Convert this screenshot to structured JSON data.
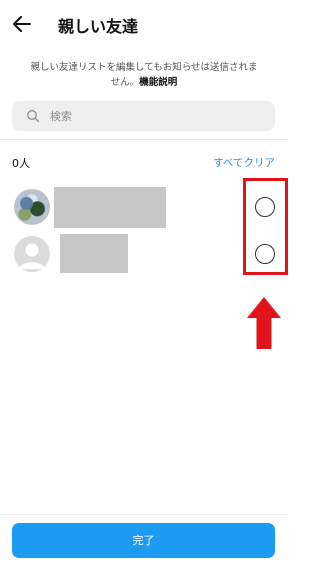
{
  "header": {
    "back_icon": "arrow-left-icon",
    "title": "親しい友達"
  },
  "description": {
    "text": "親しい友達リストを編集してもお知らせは送信されません。",
    "learn_more": "機能説明"
  },
  "search": {
    "icon": "search-icon",
    "placeholder": "検索",
    "value": ""
  },
  "selection": {
    "count_label": "0人",
    "clear_all_label": "すべてクリア"
  },
  "users": [
    {
      "avatar": "photo-avatar",
      "selected": false
    },
    {
      "avatar": "default-avatar",
      "selected": false
    }
  ],
  "annotation": {
    "highlight_color": "#e0141a",
    "arrow_icon": "arrow-up-icon"
  },
  "footer": {
    "done_label": "完了",
    "accent_color": "#1d9bf0"
  }
}
